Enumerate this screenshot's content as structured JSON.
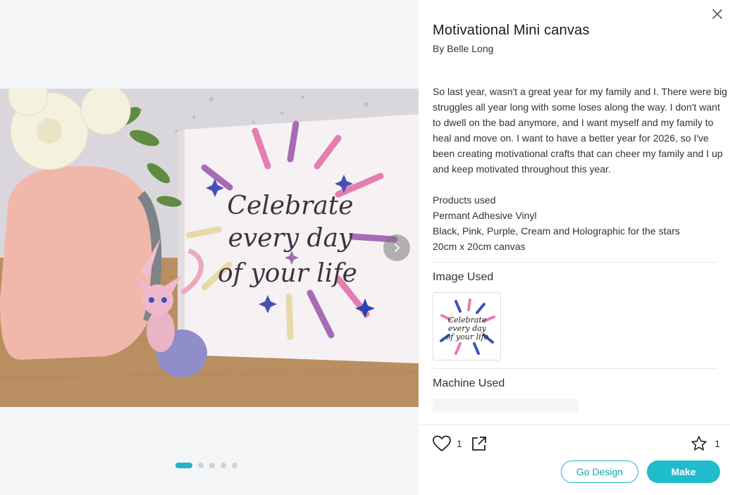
{
  "project": {
    "title": "Motivational Mini canvas",
    "byline": "By Belle Long",
    "description": "So last year, wasn't a great year for my family and I.  There were big struggles all year long with some loses along the way.  I don't want to dwell on the bad anymore, and I want myself and my family to heal and move on.  I want to have a better year for 2026, so I've been creating motivational crafts that can cheer my family and I up and keep motivated throughout this year.",
    "products": [
      "Products used",
      "Permant Adhesive Vinyl",
      "Black, Pink, Purple, Cream and Holographic for the stars",
      "20cm x 20cm canvas"
    ]
  },
  "gallery": {
    "photo_text": [
      "Celebrate",
      "every day",
      "of your life"
    ],
    "slide_count": 5,
    "active_slide": 1
  },
  "sections": {
    "image_used": "Image Used",
    "machine_used": "Machine Used"
  },
  "thumbnail_text": [
    "Celebrate",
    "every day",
    "of your life"
  ],
  "footer": {
    "like_count": "1",
    "favorite_count": "1",
    "go_design_label": "Go Design",
    "make_label": "Make"
  },
  "colors": {
    "accent": "#1fbccc",
    "pink": "#e47eb1",
    "purple": "#a66bb5",
    "blue": "#3a55b8",
    "cream": "#ead9a8"
  },
  "icons": {
    "close": "close-icon",
    "next": "chevron-right-icon",
    "like": "heart-icon",
    "share": "share-icon",
    "favorite": "star-icon"
  }
}
